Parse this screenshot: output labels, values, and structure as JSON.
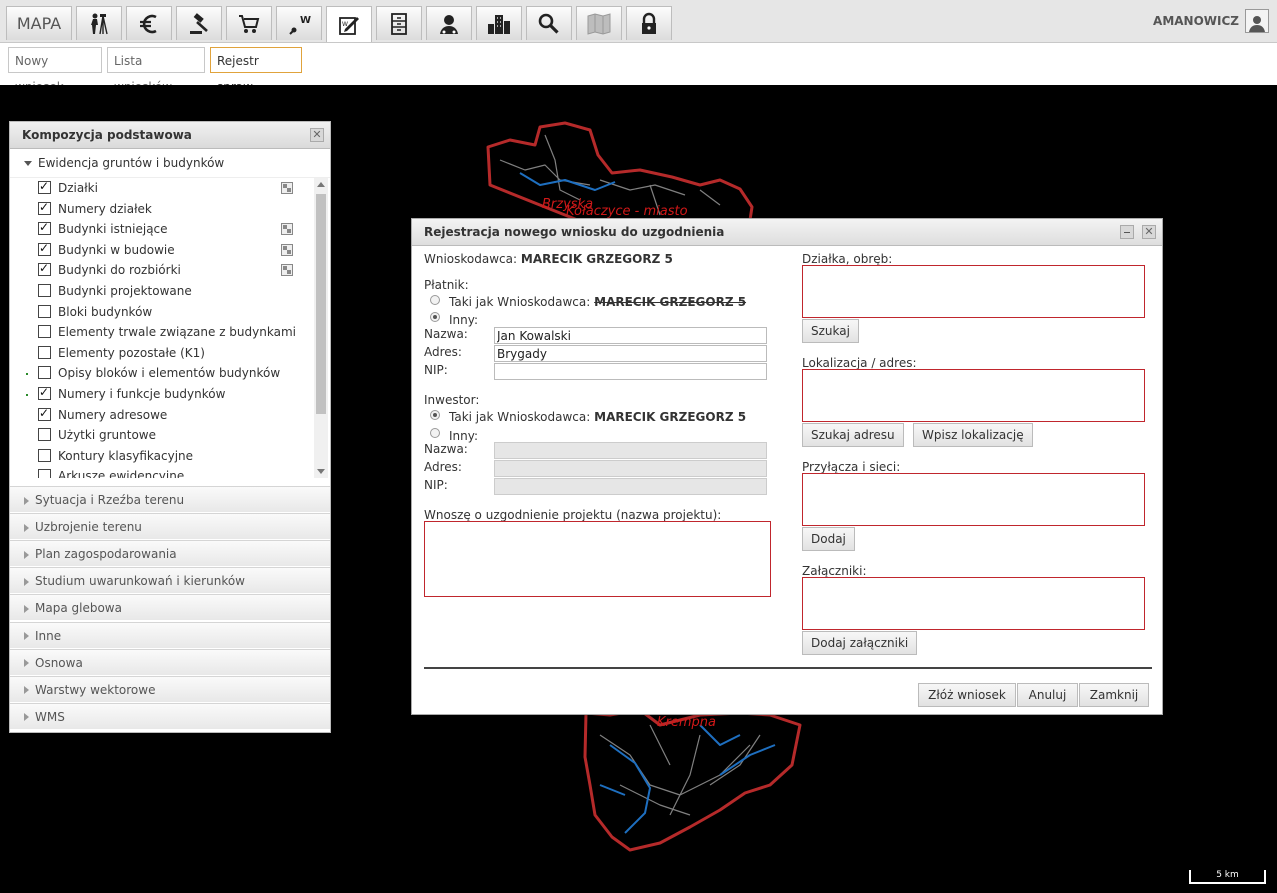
{
  "topbar": {
    "mapa_label": "MAPA",
    "tools": [
      "survey-icon",
      "euro-icon",
      "gavel-icon",
      "cart-icon",
      "pen-w-icon",
      "edit-form-icon",
      "cabinet-icon",
      "person-icon",
      "buildings-icon",
      "search-icon",
      "map-book-icon",
      "lock-icon"
    ],
    "user_name": "AMANOWICZ"
  },
  "subtabs": {
    "new_request": "Nowy wniosek",
    "request_list": "Lista wniosków",
    "case_register": "Rejestr spraw"
  },
  "map": {
    "labels": [
      "Brzyska",
      "Kołaczyce - miasto",
      "Krempna"
    ],
    "scale": "5 km"
  },
  "layers_panel": {
    "title": "Kompozycja podstawowa",
    "open_group": "Ewidencja gruntów i budynków",
    "items": [
      {
        "label": "Działki",
        "checked": true,
        "legend": true,
        "dot": false
      },
      {
        "label": "Numery działek",
        "checked": true,
        "legend": false,
        "dot": false
      },
      {
        "label": "Budynki istniejące",
        "checked": true,
        "legend": true,
        "dot": false
      },
      {
        "label": "Budynki w budowie",
        "checked": true,
        "legend": true,
        "dot": false
      },
      {
        "label": "Budynki do rozbiórki",
        "checked": true,
        "legend": true,
        "dot": false
      },
      {
        "label": "Budynki projektowane",
        "checked": false,
        "legend": false,
        "dot": false
      },
      {
        "label": "Bloki budynków",
        "checked": false,
        "legend": false,
        "dot": false
      },
      {
        "label": "Elementy trwale związane z budynkami",
        "checked": false,
        "legend": false,
        "dot": false
      },
      {
        "label": "Elementy pozostałe (K1)",
        "checked": false,
        "legend": false,
        "dot": false
      },
      {
        "label": "Opisy bloków i elementów budynków",
        "checked": false,
        "legend": false,
        "dot": true
      },
      {
        "label": "Numery i funkcje budynków",
        "checked": true,
        "legend": false,
        "dot": true
      },
      {
        "label": "Numery adresowe",
        "checked": true,
        "legend": false,
        "dot": false
      },
      {
        "label": "Użytki gruntowe",
        "checked": false,
        "legend": false,
        "dot": false
      },
      {
        "label": "Kontury klasyfikacyjne",
        "checked": false,
        "legend": false,
        "dot": false
      },
      {
        "label": "Arkusze ewidencyjne",
        "checked": false,
        "legend": false,
        "dot": false
      }
    ],
    "groups": [
      "Sytuacja i Rzeźba terenu",
      "Uzbrojenie terenu",
      "Plan zagospodarowania",
      "Studium uwarunkowań i kierunków",
      "Mapa glebowa",
      "Inne",
      "Osnowa",
      "Warstwy wektorowe",
      "WMS"
    ]
  },
  "dialog": {
    "title": "Rejestracja nowego wniosku do uzgodnienia",
    "applicant_label": "Wnioskodawca:",
    "applicant_name": "MARECIK GRZEGORZ 5",
    "payer_label": "Płatnik:",
    "same_as_label": "Taki jak Wnioskodawca:",
    "payer_same_name": "MARECIK GRZEGORZ 5",
    "other_label": "Inny:",
    "name_label": "Nazwa:",
    "address_label": "Adres:",
    "nip_label": "NIP:",
    "payer_name_value": "Jan Kowalski",
    "payer_address_value": "Brygady",
    "payer_nip_value": "",
    "investor_label": "Inwestor:",
    "investor_same_name": "MARECIK GRZEGORZ 5",
    "project_label": "Wnoszę o uzgodnienie projektu (nazwa projektu):",
    "parcel_label": "Działka, obręb:",
    "search_button": "Szukaj",
    "location_label": "Lokalizacja / adres:",
    "search_address_button": "Szukaj adresu",
    "enter_location_button": "Wpisz lokalizację",
    "connections_label": "Przyłącza i sieci:",
    "add_button": "Dodaj",
    "attachments_label": "Załączniki:",
    "add_attachments_button": "Dodaj załączniki",
    "submit_button": "Złóż wniosek",
    "cancel_button": "Anuluj",
    "close_button": "Zamknij"
  },
  "colors": {
    "accent_tab_border": "#e0a33c",
    "required_border": "#c0262d",
    "map_background": "#000000",
    "boundary": "#b52a2a"
  }
}
